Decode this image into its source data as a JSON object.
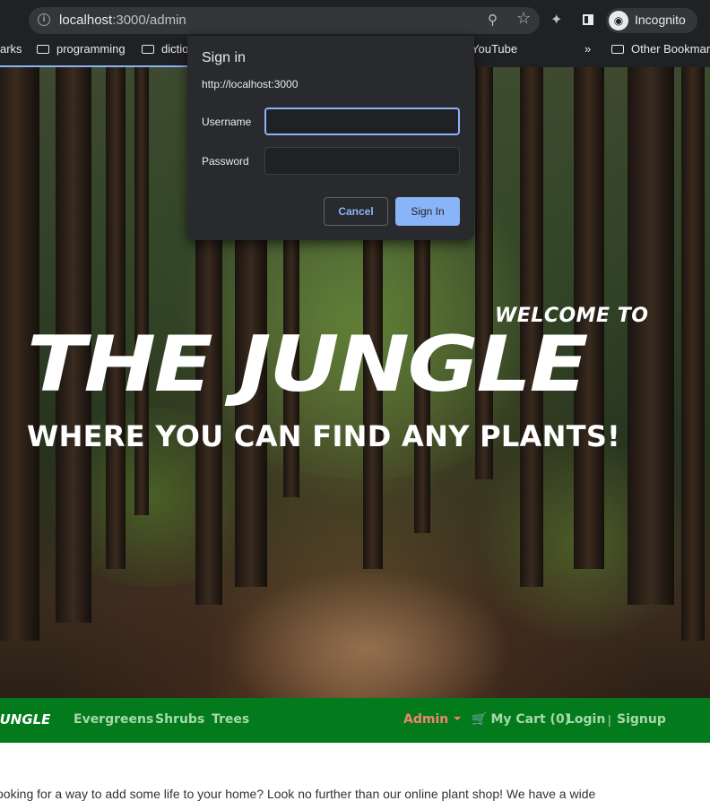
{
  "browser": {
    "url_host": "localhost",
    "url_path": ":3000/admin",
    "profile_label": "Incognito",
    "bookmarks": [
      {
        "label": "arks"
      },
      {
        "label": "programming"
      },
      {
        "label": "dictio"
      },
      {
        "label": "YouTube"
      },
      {
        "label": "»"
      },
      {
        "label": "Other Bookmar"
      }
    ]
  },
  "dialog": {
    "title": "Sign in",
    "origin": "http://localhost:3000",
    "username_label": "Username",
    "username_value": "",
    "password_label": "Password",
    "password_value": "",
    "cancel_label": "Cancel",
    "signin_label": "Sign In"
  },
  "hero": {
    "welcome": "WELCOME TO",
    "title": "THE JUNGLE",
    "tagline": "WHERE YOU CAN FIND ANY PLANTS!"
  },
  "nav": {
    "brand": "JUNGLE",
    "links": [
      "Evergreens",
      "Shrubs",
      "Trees"
    ],
    "admin": "Admin",
    "cart": "My Cart (0)",
    "login": "Login",
    "separator": "|",
    "signup": "Signup"
  },
  "content": {
    "intro": "ooking for a way to add some life to your home? Look no further than our online plant shop! We have a wide"
  }
}
